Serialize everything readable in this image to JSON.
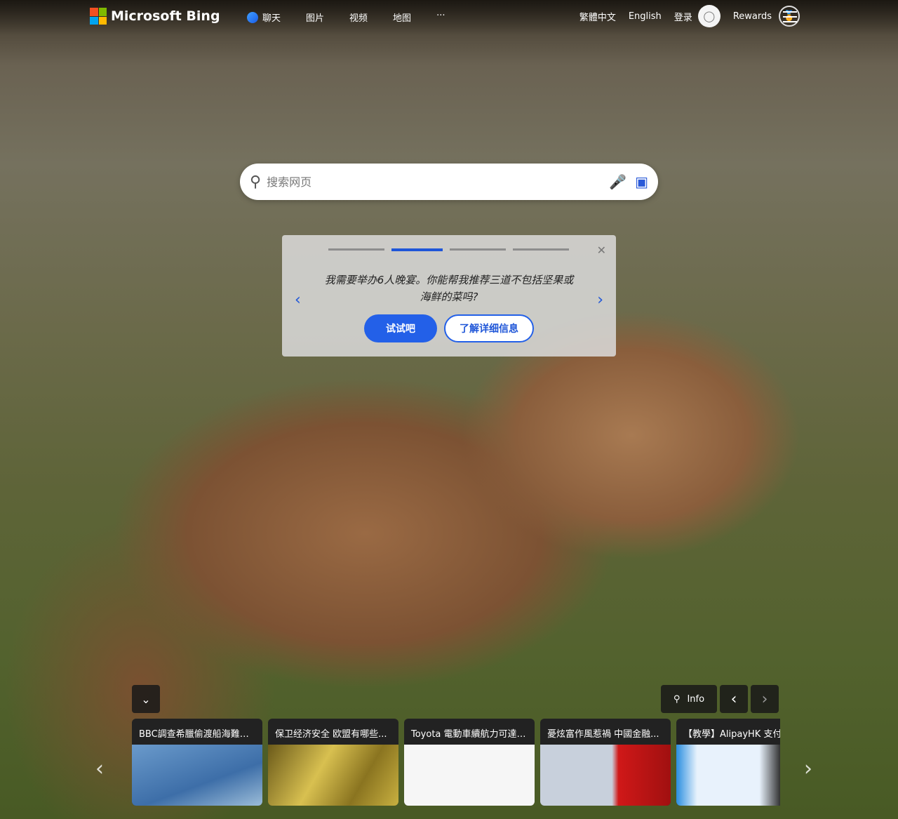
{
  "header": {
    "logo": "Microsoft Bing",
    "nav": [
      "聊天",
      "图片",
      "视频",
      "地图",
      "···"
    ],
    "lang_trad": "繁體中文",
    "lang_en": "English",
    "signin": "登录",
    "rewards": "Rewards"
  },
  "search": {
    "placeholder": "搜索网页"
  },
  "prompt_card": {
    "text": "我需要举办6人晚宴。你能帮我推荐三道不包括坚果或海鲜的菜吗?",
    "try_label": "试试吧",
    "learn_label": "了解详细信息",
    "active_step": 2,
    "total_steps": 4
  },
  "bottom": {
    "info_label": "Info"
  },
  "news": [
    {
      "title": "BBC調查希臘偷渡船海難：..."
    },
    {
      "title": "保卫经济安全 欧盟有哪些..."
    },
    {
      "title": "Toyota 電動車續航力可達 ..."
    },
    {
      "title": "憂炫富作風惹禍 中國金融..."
    },
    {
      "title": "【教學】AlipayHK 支付寶"
    }
  ]
}
